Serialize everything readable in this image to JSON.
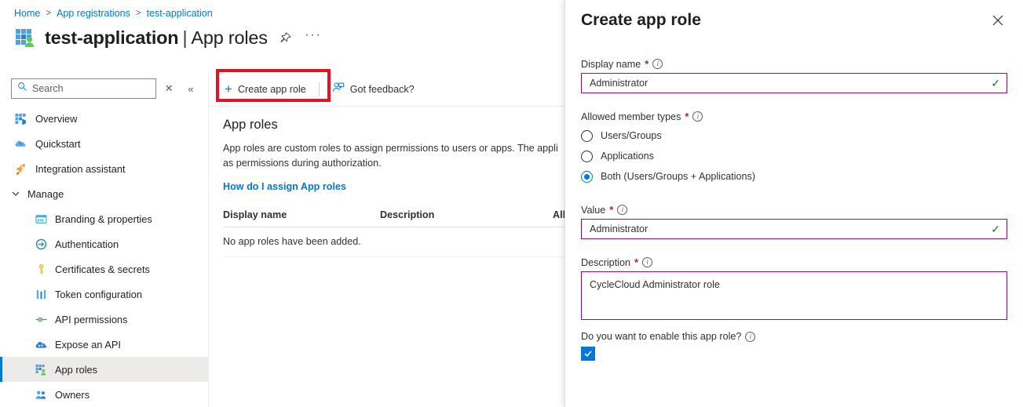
{
  "breadcrumb": {
    "items": [
      "Home",
      "App registrations",
      "test-application"
    ],
    "separator": ">"
  },
  "header": {
    "app_name": "test-application",
    "divider": "|",
    "page_section": "App roles",
    "pin_icon": "pin-icon",
    "more_icon": "ellipsis-icon",
    "more_label": "···"
  },
  "sidebar": {
    "search": {
      "placeholder": "Search",
      "value": "",
      "search_icon": "search-icon"
    },
    "clear_label": "✕",
    "collapse_label": "«",
    "items": [
      {
        "label": "Overview",
        "icon": "overview-grid-icon",
        "level": "top",
        "selected": false
      },
      {
        "label": "Quickstart",
        "icon": "quickstart-cloud-icon",
        "level": "top",
        "selected": false
      },
      {
        "label": "Integration assistant",
        "icon": "rocket-icon",
        "level": "top",
        "selected": false
      },
      {
        "label": "Manage",
        "icon": "chevron-down-icon",
        "level": "group",
        "selected": false
      },
      {
        "label": "Branding & properties",
        "icon": "branding-card-icon",
        "level": "indent",
        "selected": false
      },
      {
        "label": "Authentication",
        "icon": "authentication-arrow-icon",
        "level": "indent",
        "selected": false
      },
      {
        "label": "Certificates & secrets",
        "icon": "key-icon",
        "level": "indent",
        "selected": false
      },
      {
        "label": "Token configuration",
        "icon": "token-bars-icon",
        "level": "indent",
        "selected": false
      },
      {
        "label": "API permissions",
        "icon": "api-permissions-icon",
        "level": "indent",
        "selected": false
      },
      {
        "label": "Expose an API",
        "icon": "expose-api-cloud-icon",
        "level": "indent",
        "selected": false
      },
      {
        "label": "App roles",
        "icon": "app-roles-icon",
        "level": "indent",
        "selected": true
      },
      {
        "label": "Owners",
        "icon": "owners-people-icon",
        "level": "indent",
        "selected": false
      }
    ]
  },
  "toolbar": {
    "create_label": "Create app role",
    "create_icon": "plus-icon",
    "feedback_label": "Got feedback?",
    "feedback_icon": "feedback-person-icon"
  },
  "main": {
    "section_title": "App roles",
    "description": "App roles are custom roles to assign permissions to users or apps. The appli\nas permissions during authorization.",
    "assign_link": "How do I assign App roles",
    "table": {
      "columns": [
        "Display name",
        "Description",
        "Allowed"
      ],
      "empty_message": "No app roles have been added."
    }
  },
  "panel": {
    "title": "Create app role",
    "close_icon": "close-icon",
    "close_label": "✕",
    "fields": {
      "display_name": {
        "label": "Display name",
        "required_mark": "*",
        "info_icon": "info-icon",
        "value": "Administrator",
        "valid_icon": "checkmark-icon",
        "valid_mark": "✓"
      },
      "allowed_member_types": {
        "label": "Allowed member types",
        "required_mark": "*",
        "info_icon": "info-icon",
        "options": [
          {
            "label": "Users/Groups",
            "selected": false
          },
          {
            "label": "Applications",
            "selected": false
          },
          {
            "label": "Both (Users/Groups + Applications)",
            "selected": true
          }
        ]
      },
      "value": {
        "label": "Value",
        "required_mark": "*",
        "info_icon": "info-icon",
        "value": "Administrator",
        "valid_icon": "checkmark-icon",
        "valid_mark": "✓"
      },
      "description": {
        "label": "Description",
        "required_mark": "*",
        "info_icon": "info-icon",
        "value": "CycleCloud Administrator role"
      },
      "enable": {
        "label": "Do you want to enable this app role?",
        "info_icon": "info-icon",
        "checked": true
      }
    }
  },
  "colors": {
    "accent_blue": "#0078d4",
    "focus_purple": "#8a0f8a",
    "required_red": "#a4262c",
    "highlight_red": "#e81123",
    "valid_green": "#107c10"
  }
}
